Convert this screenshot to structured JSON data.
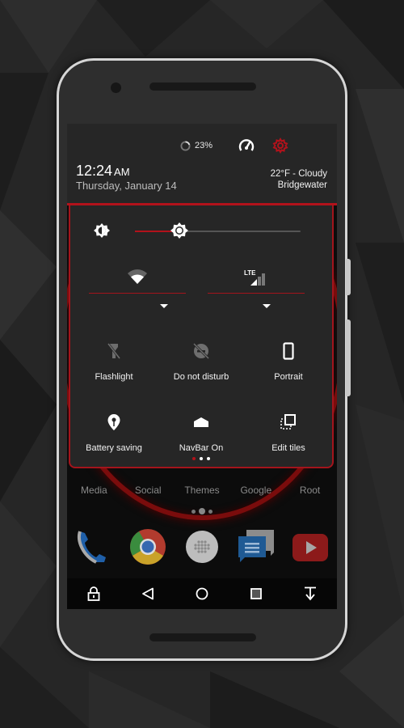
{
  "colors": {
    "accent": "#b2121b",
    "panel": "#262626",
    "text_primary": "#ffffff",
    "text_secondary": "#bdbdbd"
  },
  "status_bar": {
    "battery_icon": "battery-ring-icon",
    "battery_percent": "23%",
    "speed_icon": "speedometer-icon",
    "settings_icon": "gear-icon"
  },
  "header": {
    "time": "12:24",
    "ampm": "AM",
    "date": "Thursday, January 14",
    "weather": "22°F - Cloudy",
    "location": "Bridgewater"
  },
  "brightness": {
    "icon": "brightness-auto-icon",
    "level_percent": 27
  },
  "network": {
    "wifi": {
      "icon": "wifi-icon"
    },
    "cellular": {
      "icon": "lte-signal-icon",
      "badge": "LTE"
    }
  },
  "tiles": [
    {
      "label": "Flashlight",
      "icon": "flashlight-off-icon",
      "active": false
    },
    {
      "label": "Do not disturb",
      "icon": "do-not-disturb-off-icon",
      "active": false
    },
    {
      "label": "Portrait",
      "icon": "portrait-icon",
      "active": true
    },
    {
      "label": "Battery saving",
      "icon": "battery-saver-icon",
      "active": true
    },
    {
      "label": "NavBar On",
      "icon": "navbar-icon",
      "active": true
    },
    {
      "label": "Edit tiles",
      "icon": "edit-tiles-icon",
      "active": true
    }
  ],
  "qs_pages": {
    "count": 3,
    "current": 1
  },
  "home": {
    "folders": [
      "Media",
      "Social",
      "Themes",
      "Google",
      "Root"
    ],
    "page_indicator": {
      "count": 3,
      "current": 2
    },
    "dock": [
      {
        "name": "Phone",
        "icon": "phone-icon"
      },
      {
        "name": "Chrome",
        "icon": "chrome-icon"
      },
      {
        "name": "App drawer",
        "icon": "app-drawer-icon"
      },
      {
        "name": "Messages",
        "icon": "messages-icon"
      },
      {
        "name": "YouTube",
        "icon": "youtube-icon"
      }
    ]
  },
  "navbar": [
    "lock-icon",
    "back-icon",
    "home-icon",
    "recents-icon",
    "pull-down-icon"
  ]
}
